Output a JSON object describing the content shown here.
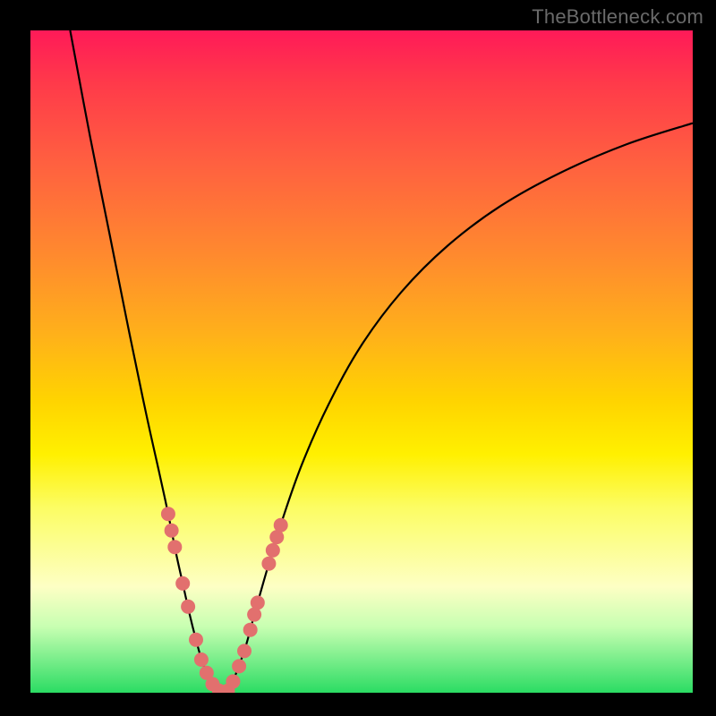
{
  "watermark": "TheBottleneck.com",
  "colors": {
    "background": "#000000",
    "curve_stroke": "#000000",
    "marker_fill": "#e2706e",
    "gradient_stops": [
      "#ff1a58",
      "#ff3a4a",
      "#ff6040",
      "#ff8a2e",
      "#ffb11a",
      "#ffd400",
      "#fff000",
      "#fcfd63",
      "#fdffc4",
      "#c8ffb2",
      "#2bdc63"
    ]
  },
  "chart_data": {
    "type": "line",
    "title": "",
    "xlabel": "",
    "ylabel": "",
    "ylim": [
      0,
      100
    ],
    "xlim": [
      0,
      100
    ],
    "curves": [
      {
        "name": "left-branch",
        "points": [
          {
            "x": 6.0,
            "y": 100.0
          },
          {
            "x": 9.0,
            "y": 84.0
          },
          {
            "x": 12.0,
            "y": 69.0
          },
          {
            "x": 15.0,
            "y": 54.0
          },
          {
            "x": 17.5,
            "y": 42.0
          },
          {
            "x": 19.5,
            "y": 33.0
          },
          {
            "x": 20.8,
            "y": 27.0
          },
          {
            "x": 22.0,
            "y": 21.0
          },
          {
            "x": 23.0,
            "y": 16.5
          },
          {
            "x": 24.0,
            "y": 12.0
          },
          {
            "x": 25.0,
            "y": 8.0
          },
          {
            "x": 26.0,
            "y": 4.5
          },
          {
            "x": 27.0,
            "y": 2.2
          },
          {
            "x": 28.0,
            "y": 0.8
          },
          {
            "x": 29.0,
            "y": 0.0
          }
        ]
      },
      {
        "name": "right-branch",
        "points": [
          {
            "x": 29.0,
            "y": 0.0
          },
          {
            "x": 30.0,
            "y": 0.6
          },
          {
            "x": 31.0,
            "y": 2.8
          },
          {
            "x": 32.5,
            "y": 7.0
          },
          {
            "x": 34.0,
            "y": 12.5
          },
          {
            "x": 36.0,
            "y": 19.5
          },
          {
            "x": 38.0,
            "y": 26.0
          },
          {
            "x": 41.0,
            "y": 34.5
          },
          {
            "x": 45.0,
            "y": 43.5
          },
          {
            "x": 50.0,
            "y": 52.5
          },
          {
            "x": 56.0,
            "y": 60.5
          },
          {
            "x": 63.0,
            "y": 67.5
          },
          {
            "x": 71.0,
            "y": 73.5
          },
          {
            "x": 80.0,
            "y": 78.5
          },
          {
            "x": 90.0,
            "y": 82.8
          },
          {
            "x": 100.0,
            "y": 86.0
          }
        ]
      }
    ],
    "markers": [
      {
        "x": 20.8,
        "y": 27.0
      },
      {
        "x": 21.3,
        "y": 24.5
      },
      {
        "x": 21.8,
        "y": 22.0
      },
      {
        "x": 23.0,
        "y": 16.5
      },
      {
        "x": 23.8,
        "y": 13.0
      },
      {
        "x": 25.0,
        "y": 8.0
      },
      {
        "x": 25.8,
        "y": 5.0
      },
      {
        "x": 26.6,
        "y": 3.0
      },
      {
        "x": 27.5,
        "y": 1.3
      },
      {
        "x": 28.5,
        "y": 0.3
      },
      {
        "x": 29.2,
        "y": 0.0
      },
      {
        "x": 29.8,
        "y": 0.3
      },
      {
        "x": 30.6,
        "y": 1.7
      },
      {
        "x": 31.5,
        "y": 4.0
      },
      {
        "x": 32.3,
        "y": 6.3
      },
      {
        "x": 33.2,
        "y": 9.5
      },
      {
        "x": 33.8,
        "y": 11.8
      },
      {
        "x": 34.3,
        "y": 13.6
      },
      {
        "x": 36.0,
        "y": 19.5
      },
      {
        "x": 36.6,
        "y": 21.5
      },
      {
        "x": 37.2,
        "y": 23.5
      },
      {
        "x": 37.8,
        "y": 25.3
      }
    ]
  }
}
